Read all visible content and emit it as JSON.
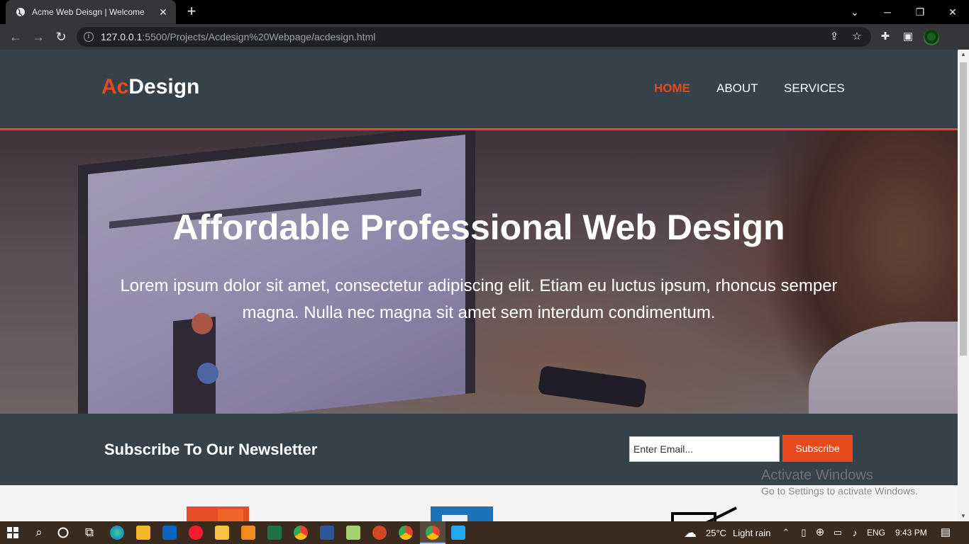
{
  "browser": {
    "tab_title": "Acme Web Deisgn | Welcome",
    "tab_close": "✕",
    "new_tab": "+",
    "url_host": "127.0.0.1",
    "url_path": ":5500/Projects/Acdesign%20Webpage/acdesign.html"
  },
  "site": {
    "logo_accent": "Ac",
    "logo_rest": "Design",
    "nav": [
      "HOME",
      "ABOUT",
      "SERVICES"
    ],
    "active_nav": "HOME",
    "hero_title": "Affordable Professional Web Design",
    "hero_text": "Lorem ipsum dolor sit amet, consectetur adipiscing elit. Etiam eu luctus ipsum, rhoncus semper magna. Nulla nec magna sit amet sem interdum condimentum.",
    "newsletter_heading": "Subscribe To Our Newsletter",
    "email_placeholder": "Enter Email...",
    "subscribe_label": "Subscribe",
    "colors": {
      "header_bg": "#35424a",
      "accent": "#e8491d"
    }
  },
  "watermark": {
    "line1": "Activate Windows",
    "line2": "Go to Settings to activate Windows."
  },
  "taskbar": {
    "weather": "25°C",
    "weather_desc": "Light rain",
    "language": "ENG",
    "time": "9:43 PM",
    "pinned_icons": [
      "start-icon",
      "search-icon",
      "cortana-icon",
      "task-view-icon",
      "edge-icon",
      "store-icon",
      "mail-icon",
      "opera-icon",
      "file-explorer-icon",
      "sublime-icon",
      "excel-icon",
      "chrome-icon",
      "word-icon",
      "notepad-icon",
      "powerpoint-icon",
      "chrome-icon",
      "chrome-active-icon",
      "vscode-icon"
    ]
  }
}
